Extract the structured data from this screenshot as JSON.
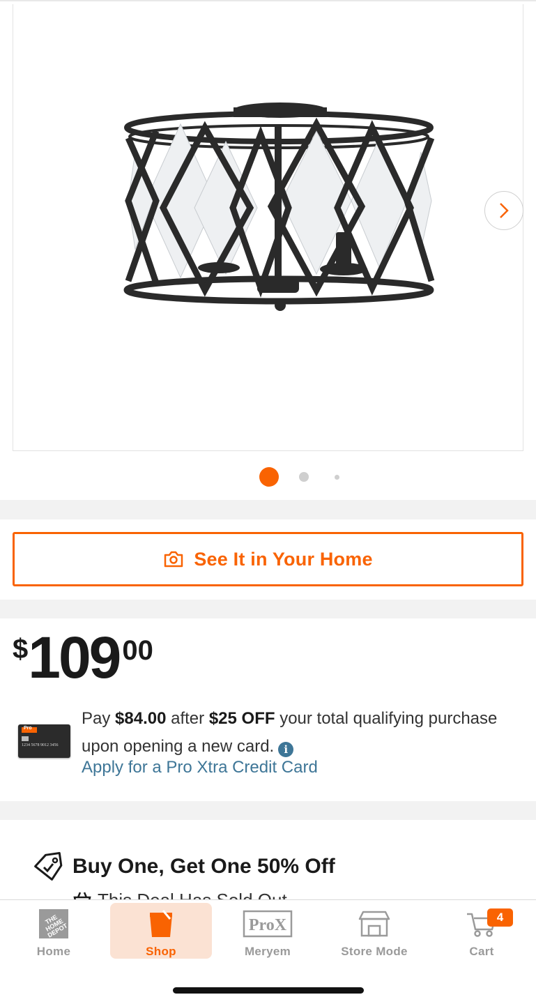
{
  "gallery": {
    "image_count": 3,
    "active_index": 0,
    "colors": {
      "active_dot": "#f96302",
      "inactive_dot": "#cfcfcf"
    }
  },
  "ar_button": {
    "label": "See It in Your Home",
    "icon": "camera-icon"
  },
  "price": {
    "currency": "$",
    "dollars": "109",
    "cents": "00"
  },
  "promo": {
    "text_pay": "Pay",
    "amount": "$84.00",
    "text_after": "after",
    "discount": "$25 OFF",
    "text_rest": "your total qualifying purchase upon opening a new card.",
    "info_icon": "info-icon",
    "apply_link": "Apply for a Pro Xtra Credit Card",
    "card_number": "1234 5678 9012 3456",
    "card_brand": "Pro"
  },
  "deal": {
    "title": "Buy One, Get One 50% Off",
    "subtitle": "This Deal Has Sold Out",
    "icon": "tag-icon"
  },
  "bottom_nav": {
    "items": [
      {
        "label": "Home",
        "icon": "home-depot-logo-icon",
        "active": false
      },
      {
        "label": "Shop",
        "icon": "shop-bucket-icon",
        "active": true
      },
      {
        "label": "Meryem",
        "icon": "prox-icon",
        "active": false
      },
      {
        "label": "Store Mode",
        "icon": "store-icon",
        "active": false
      },
      {
        "label": "Cart",
        "icon": "cart-icon",
        "active": false
      }
    ],
    "cart_count": "4",
    "prox_text": "ProX",
    "colors": {
      "accent": "#f96302",
      "inactive": "#9a9a9a",
      "link": "#3e7697"
    }
  }
}
